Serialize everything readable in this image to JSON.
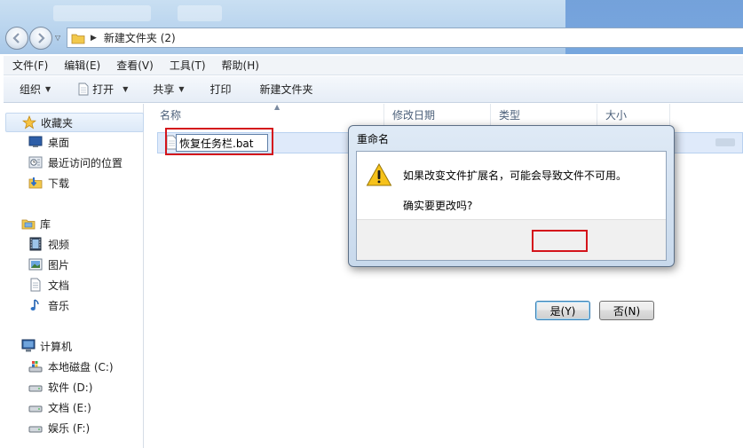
{
  "address_bar": {
    "path": "新建文件夹 (2)"
  },
  "menu": [
    {
      "label": "文件(F)"
    },
    {
      "label": "编辑(E)"
    },
    {
      "label": "查看(V)"
    },
    {
      "label": "工具(T)"
    },
    {
      "label": "帮助(H)"
    }
  ],
  "toolbar": {
    "organize": "组织",
    "open": "打开",
    "share": "共享",
    "print": "打印",
    "new_folder": "新建文件夹"
  },
  "nav": {
    "favorites": {
      "label": "收藏夹",
      "items": [
        "桌面",
        "最近访问的位置",
        "下载"
      ]
    },
    "libraries": {
      "label": "库",
      "items": [
        "视频",
        "图片",
        "文档",
        "音乐"
      ]
    },
    "computer": {
      "label": "计算机",
      "items": [
        "本地磁盘 (C:)",
        "软件 (D:)",
        "文档 (E:)",
        "娱乐 (F:)"
      ]
    }
  },
  "columns": {
    "name": "名称",
    "date": "修改日期",
    "type": "类型",
    "size": "大小"
  },
  "file": {
    "rename_value": "恢复任务栏.bat"
  },
  "dialog": {
    "title": "重命名",
    "message": "如果改变文件扩展名，可能会导致文件不可用。",
    "question": "确实要更改吗?",
    "yes_label": "是(Y)",
    "no_label": "否(N)"
  },
  "colors": {
    "highlight_outline": "#d4141b",
    "selection": "#dfeafa"
  },
  "icons": {
    "warning": "warning-icon",
    "star": "star-icon",
    "folder": "folder-icon"
  }
}
